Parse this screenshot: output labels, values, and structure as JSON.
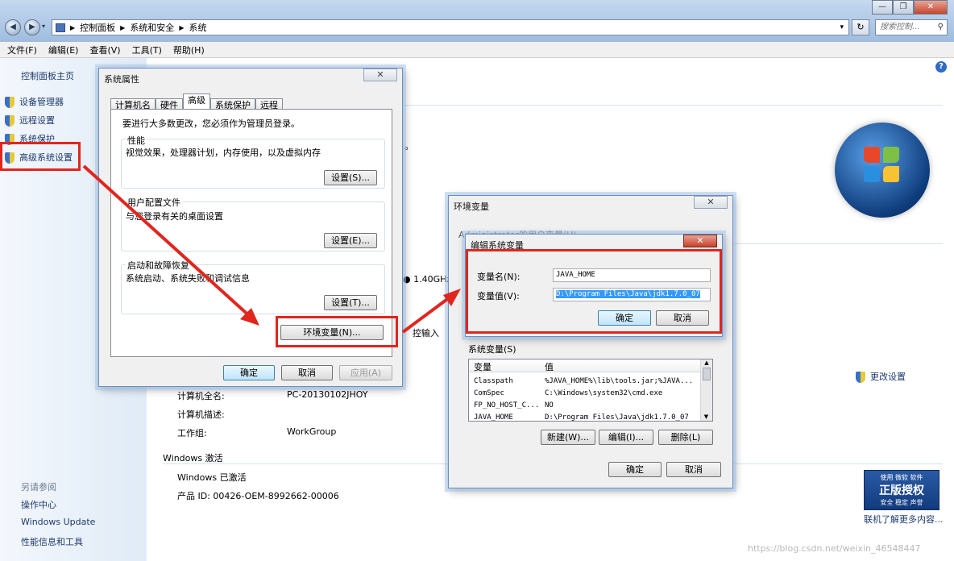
{
  "explorer": {
    "breadcrumbs": [
      "控制面板",
      "系统和安全",
      "系统"
    ],
    "search_placeholder": "搜索控制...",
    "menu": [
      "文件(F)",
      "编辑(E)",
      "查看(V)",
      "工具(T)",
      "帮助(H)"
    ]
  },
  "left_pane": {
    "home": "控制面板主页",
    "links": [
      "设备管理器",
      "远程设置",
      "系统保护",
      "高级系统设置"
    ],
    "see_also_title": "另请参阅",
    "see_also": [
      "操作中心",
      "Windows Update",
      "性能信息和工具"
    ]
  },
  "main": {
    "cpu_speed": "1.40GHz",
    "pen_input_fragment": "控输入",
    "change_settings": "更改设置",
    "rows": [
      {
        "label": "计算机全名:",
        "value": "PC-20130102JHOY"
      },
      {
        "label": "计算机描述:",
        "value": ""
      },
      {
        "label": "工作组:",
        "value": "WorkGroup"
      }
    ],
    "activation_title": "Windows 激活",
    "activation_status": "Windows 已激活",
    "product_id": "产品 ID: 00426-OEM-8992662-00006",
    "genuine_line1": "使用 微软 软件",
    "genuine_line2": "正版授权",
    "genuine_line3": "安全 稳定 声誉",
    "genuine_link": "联机了解更多内容...",
    "watermark": "https://blog.csdn.net/weixin_46548447"
  },
  "sysprops": {
    "title": "系统属性",
    "tabs": [
      "计算机名",
      "硬件",
      "高级",
      "系统保护",
      "远程"
    ],
    "admin_note": "要进行大多数更改，您必须作为管理员登录。",
    "perf_title": "性能",
    "perf_desc": "视觉效果，处理器计划，内存使用，以及虚拟内存",
    "profile_title": "用户配置文件",
    "profile_desc": "与您登录有关的桌面设置",
    "startup_title": "启动和故障恢复",
    "startup_desc": "系统启动、系统失败和调试信息",
    "settings_s": "设置(S)...",
    "settings_e": "设置(E)...",
    "settings_t": "设置(T)...",
    "env_button": "环境变量(N)...",
    "ok": "确定",
    "cancel": "取消",
    "apply": "应用(A)"
  },
  "envvars": {
    "title": "环境变量",
    "user_vars_label": "的用户变量(U)",
    "user_fragment": "Administrator",
    "sys_vars_label": "系统变量(S)",
    "col_var": "变量",
    "col_val": "值",
    "rows": [
      {
        "name": "Classpath",
        "value": "%JAVA_HOME%\\lib\\tools.jar;%JAVA..."
      },
      {
        "name": "ComSpec",
        "value": "C:\\Windows\\system32\\cmd.exe"
      },
      {
        "name": "FP_NO_HOST_C...",
        "value": "NO"
      },
      {
        "name": "JAVA_HOME",
        "value": "D:\\Program Files\\Java\\jdk1.7.0_07"
      }
    ],
    "new_btn": "新建(W)...",
    "edit_btn": "编辑(I)...",
    "delete_btn": "删除(L)",
    "ok": "确定",
    "cancel": "取消"
  },
  "editvar": {
    "title": "编辑系统变量",
    "name_label": "变量名(N):",
    "value_label": "变量值(V):",
    "name_value": "JAVA_HOME",
    "value_value": "D:\\Program Files\\Java\\jdk1.7.0_07",
    "ok": "确定",
    "cancel": "取消"
  },
  "colors": {
    "annotation_red": "#e0261e",
    "selection_blue": "#3399ff",
    "link_blue": "#1e3a6e"
  }
}
